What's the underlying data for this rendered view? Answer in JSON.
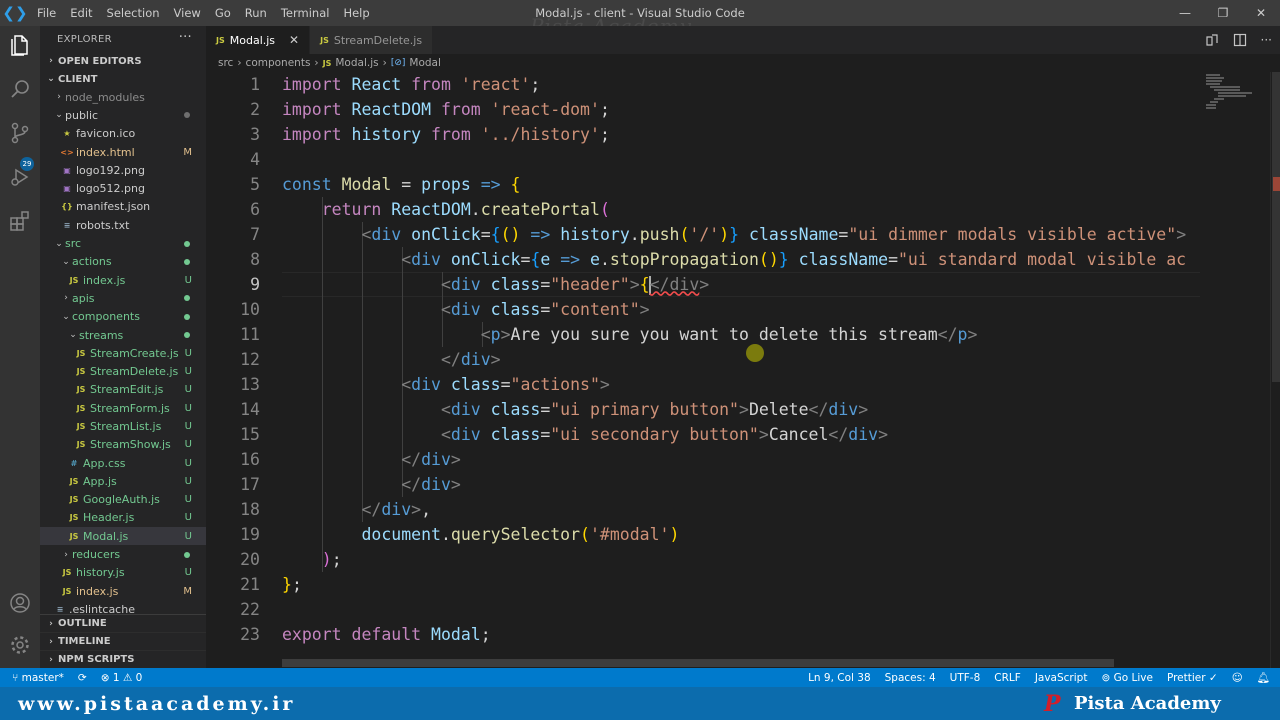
{
  "window": {
    "title": "Modal.js - client - Visual Studio Code",
    "watermark": "Pista Academy",
    "menu": [
      "File",
      "Edit",
      "Selection",
      "View",
      "Go",
      "Run",
      "Terminal",
      "Help"
    ]
  },
  "activity_bar": {
    "items": [
      "explorer-icon",
      "search-icon",
      "source-control-icon",
      "run-debug-icon",
      "extensions-icon"
    ],
    "source_control_badge": "29",
    "bottom": [
      "account-icon",
      "manage-gear-icon"
    ]
  },
  "sidebar": {
    "title": "EXPLORER",
    "more": "···",
    "open_editors": "OPEN EDITORS",
    "root": "CLIENT",
    "tree": [
      {
        "name": "node_modules",
        "type": "folder",
        "depth": 1,
        "open": false,
        "color": "gray"
      },
      {
        "name": "public",
        "type": "folder",
        "depth": 1,
        "open": true,
        "dot": "gray"
      },
      {
        "name": "favicon.ico",
        "type": "fav",
        "depth": 2
      },
      {
        "name": "index.html",
        "type": "html",
        "depth": 2,
        "status": "M"
      },
      {
        "name": "logo192.png",
        "type": "img",
        "depth": 2
      },
      {
        "name": "logo512.png",
        "type": "img",
        "depth": 2
      },
      {
        "name": "manifest.json",
        "type": "json",
        "depth": 2
      },
      {
        "name": "robots.txt",
        "type": "txt",
        "depth": 2
      },
      {
        "name": "src",
        "type": "folder",
        "depth": 1,
        "open": true,
        "dot": "green"
      },
      {
        "name": "actions",
        "type": "folder",
        "depth": 2,
        "open": true,
        "dot": "green"
      },
      {
        "name": "index.js",
        "type": "js",
        "depth": 3,
        "status": "U"
      },
      {
        "name": "apis",
        "type": "folder",
        "depth": 2,
        "open": false,
        "dot": "green"
      },
      {
        "name": "components",
        "type": "folder",
        "depth": 2,
        "open": true,
        "dot": "green"
      },
      {
        "name": "streams",
        "type": "folder",
        "depth": 3,
        "open": true,
        "dot": "green"
      },
      {
        "name": "StreamCreate.js",
        "type": "js",
        "depth": 4,
        "status": "U"
      },
      {
        "name": "StreamDelete.js",
        "type": "js",
        "depth": 4,
        "status": "U"
      },
      {
        "name": "StreamEdit.js",
        "type": "js",
        "depth": 4,
        "status": "U"
      },
      {
        "name": "StreamForm.js",
        "type": "js",
        "depth": 4,
        "status": "U"
      },
      {
        "name": "StreamList.js",
        "type": "js",
        "depth": 4,
        "status": "U"
      },
      {
        "name": "StreamShow.js",
        "type": "js",
        "depth": 4,
        "status": "U"
      },
      {
        "name": "App.css",
        "type": "css",
        "depth": 3,
        "status": "U"
      },
      {
        "name": "App.js",
        "type": "js",
        "depth": 3,
        "status": "U"
      },
      {
        "name": "GoogleAuth.js",
        "type": "js",
        "depth": 3,
        "status": "U"
      },
      {
        "name": "Header.js",
        "type": "js",
        "depth": 3,
        "status": "U"
      },
      {
        "name": "Modal.js",
        "type": "js",
        "depth": 3,
        "status": "U",
        "selected": true
      },
      {
        "name": "reducers",
        "type": "folder",
        "depth": 2,
        "open": false,
        "dot": "green"
      },
      {
        "name": "history.js",
        "type": "js",
        "depth": 2,
        "status": "U"
      },
      {
        "name": "index.js",
        "type": "js",
        "depth": 2,
        "status": "M"
      },
      {
        "name": ".eslintcache",
        "type": "txt",
        "depth": 1
      }
    ],
    "outline": "OUTLINE",
    "timeline": "TIMELINE",
    "npm_scripts": "NPM SCRIPTS"
  },
  "tabs": [
    {
      "label": "Modal.js",
      "active": true,
      "close": "✕"
    },
    {
      "label": "StreamDelete.js",
      "active": false
    }
  ],
  "breadcrumb": {
    "folders": [
      "src",
      "components"
    ],
    "file": "Modal.js",
    "symbol": "Modal"
  },
  "editor": {
    "current_line": 9,
    "line_numbers": [
      "1",
      "2",
      "3",
      "4",
      "5",
      "6",
      "7",
      "8",
      "9",
      "10",
      "11",
      "12",
      "13",
      "14",
      "15",
      "16",
      "17",
      "18",
      "19",
      "20",
      "21",
      "22",
      "23"
    ],
    "lines": [
      [
        [
          "kw",
          "import"
        ],
        [
          "txt",
          " "
        ],
        [
          "var",
          "React"
        ],
        [
          "txt",
          " "
        ],
        [
          "kw",
          "from"
        ],
        [
          "txt",
          " "
        ],
        [
          "str",
          "'react'"
        ],
        [
          "txt",
          ";"
        ]
      ],
      [
        [
          "kw",
          "import"
        ],
        [
          "txt",
          " "
        ],
        [
          "var",
          "ReactDOM"
        ],
        [
          "txt",
          " "
        ],
        [
          "kw",
          "from"
        ],
        [
          "txt",
          " "
        ],
        [
          "str",
          "'react-dom'"
        ],
        [
          "txt",
          ";"
        ]
      ],
      [
        [
          "kw",
          "import"
        ],
        [
          "txt",
          " "
        ],
        [
          "var",
          "history"
        ],
        [
          "txt",
          " "
        ],
        [
          "kw",
          "from"
        ],
        [
          "txt",
          " "
        ],
        [
          "str",
          "'../history'"
        ],
        [
          "txt",
          ";"
        ]
      ],
      [],
      [
        [
          "kw2",
          "const"
        ],
        [
          "txt",
          " "
        ],
        [
          "fn",
          "Modal"
        ],
        [
          "txt",
          " = "
        ],
        [
          "var",
          "props"
        ],
        [
          "txt",
          " "
        ],
        [
          "kw2",
          "=>"
        ],
        [
          "txt",
          " "
        ],
        [
          "yb",
          "{"
        ]
      ],
      [
        [
          "txt",
          "    "
        ],
        [
          "kw",
          "return"
        ],
        [
          "txt",
          " "
        ],
        [
          "var",
          "ReactDOM"
        ],
        [
          "txt",
          "."
        ],
        [
          "fn",
          "createPortal"
        ],
        [
          "pb",
          "("
        ]
      ],
      [
        [
          "txt",
          "        "
        ],
        [
          "br",
          "<"
        ],
        [
          "tag",
          "div"
        ],
        [
          "txt",
          " "
        ],
        [
          "attr",
          "onClick"
        ],
        [
          "txt",
          "="
        ],
        [
          "bb",
          "{"
        ],
        [
          "yb",
          "()"
        ],
        [
          "txt",
          " "
        ],
        [
          "kw2",
          "=>"
        ],
        [
          "txt",
          " "
        ],
        [
          "var",
          "history"
        ],
        [
          "txt",
          "."
        ],
        [
          "fn",
          "push"
        ],
        [
          "yb",
          "("
        ],
        [
          "str",
          "'/'"
        ],
        [
          "yb",
          ")"
        ],
        [
          "bb",
          "}"
        ],
        [
          "txt",
          " "
        ],
        [
          "attr",
          "className"
        ],
        [
          "txt",
          "="
        ],
        [
          "str",
          "\"ui dimmer modals visible active\""
        ],
        [
          "br",
          ">"
        ]
      ],
      [
        [
          "txt",
          "            "
        ],
        [
          "br",
          "<"
        ],
        [
          "tag",
          "div"
        ],
        [
          "txt",
          " "
        ],
        [
          "attr",
          "onClick"
        ],
        [
          "txt",
          "="
        ],
        [
          "bb",
          "{"
        ],
        [
          "var",
          "e"
        ],
        [
          "txt",
          " "
        ],
        [
          "kw2",
          "=>"
        ],
        [
          "txt",
          " "
        ],
        [
          "var",
          "e"
        ],
        [
          "txt",
          "."
        ],
        [
          "fn",
          "stopPropagation"
        ],
        [
          "yb",
          "()"
        ],
        [
          "bb",
          "}"
        ],
        [
          "txt",
          " "
        ],
        [
          "attr",
          "className"
        ],
        [
          "txt",
          "="
        ],
        [
          "str",
          "\"ui standard modal visible ac"
        ]
      ],
      [
        [
          "txt",
          "                "
        ],
        [
          "br",
          "<"
        ],
        [
          "tag",
          "div"
        ],
        [
          "txt",
          " "
        ],
        [
          "attr",
          "class"
        ],
        [
          "txt",
          "="
        ],
        [
          "str",
          "\"header\""
        ],
        [
          "br",
          ">"
        ],
        [
          "yb",
          "{"
        ],
        [
          "caret",
          ""
        ],
        [
          "squig",
          "</div"
        ],
        [
          "br",
          ">"
        ]
      ],
      [
        [
          "txt",
          "                "
        ],
        [
          "br",
          "<"
        ],
        [
          "tag",
          "div"
        ],
        [
          "txt",
          " "
        ],
        [
          "attr",
          "class"
        ],
        [
          "txt",
          "="
        ],
        [
          "str",
          "\"content\""
        ],
        [
          "br",
          ">"
        ]
      ],
      [
        [
          "txt",
          "                    "
        ],
        [
          "br",
          "<"
        ],
        [
          "tag",
          "p"
        ],
        [
          "br",
          ">"
        ],
        [
          "txt",
          "Are you sure you want to delete this stream"
        ],
        [
          "br",
          "</"
        ],
        [
          "tag",
          "p"
        ],
        [
          "br",
          ">"
        ]
      ],
      [
        [
          "txt",
          "                "
        ],
        [
          "br",
          "</"
        ],
        [
          "tag",
          "div"
        ],
        [
          "br",
          ">"
        ]
      ],
      [
        [
          "txt",
          "            "
        ],
        [
          "br",
          "<"
        ],
        [
          "tag",
          "div"
        ],
        [
          "txt",
          " "
        ],
        [
          "attr",
          "class"
        ],
        [
          "txt",
          "="
        ],
        [
          "str",
          "\"actions\""
        ],
        [
          "br",
          ">"
        ]
      ],
      [
        [
          "txt",
          "                "
        ],
        [
          "br",
          "<"
        ],
        [
          "tag",
          "div"
        ],
        [
          "txt",
          " "
        ],
        [
          "attr",
          "class"
        ],
        [
          "txt",
          "="
        ],
        [
          "str",
          "\"ui primary button\""
        ],
        [
          "br",
          ">"
        ],
        [
          "txt",
          "Delete"
        ],
        [
          "br",
          "</"
        ],
        [
          "tag",
          "div"
        ],
        [
          "br",
          ">"
        ]
      ],
      [
        [
          "txt",
          "                "
        ],
        [
          "br",
          "<"
        ],
        [
          "tag",
          "div"
        ],
        [
          "txt",
          " "
        ],
        [
          "attr",
          "class"
        ],
        [
          "txt",
          "="
        ],
        [
          "str",
          "\"ui secondary button\""
        ],
        [
          "br",
          ">"
        ],
        [
          "txt",
          "Cancel"
        ],
        [
          "br",
          "</"
        ],
        [
          "tag",
          "div"
        ],
        [
          "br",
          ">"
        ]
      ],
      [
        [
          "txt",
          "            "
        ],
        [
          "br",
          "</"
        ],
        [
          "tag",
          "div"
        ],
        [
          "br",
          ">"
        ]
      ],
      [
        [
          "txt",
          "            "
        ],
        [
          "br",
          "</"
        ],
        [
          "tag",
          "div"
        ],
        [
          "br",
          ">"
        ]
      ],
      [
        [
          "txt",
          "        "
        ],
        [
          "br",
          "</"
        ],
        [
          "tag",
          "div"
        ],
        [
          "br",
          ">"
        ],
        [
          "txt",
          ","
        ]
      ],
      [
        [
          "txt",
          "        "
        ],
        [
          "var",
          "document"
        ],
        [
          "txt",
          "."
        ],
        [
          "fn",
          "querySelector"
        ],
        [
          "yb",
          "("
        ],
        [
          "str",
          "'#modal'"
        ],
        [
          "yb",
          ")"
        ]
      ],
      [
        [
          "txt",
          "    "
        ],
        [
          "pb",
          ")"
        ],
        [
          "txt",
          ";"
        ]
      ],
      [
        [
          "yb",
          "}"
        ],
        [
          "txt",
          ";"
        ]
      ],
      [],
      [
        [
          "kw",
          "export"
        ],
        [
          "txt",
          " "
        ],
        [
          "kw",
          "default"
        ],
        [
          "txt",
          " "
        ],
        [
          "var",
          "Modal"
        ],
        [
          "txt",
          ";"
        ]
      ]
    ]
  },
  "statusbar": {
    "branch": "master*",
    "sync": "⟳",
    "problems": "⊗ 1 ⚠ 0",
    "position": "Ln 9, Col 38",
    "spaces": "Spaces: 4",
    "encoding": "UTF-8",
    "eol": "CRLF",
    "language": "JavaScript",
    "golive": "Go Live",
    "prettier": "Prettier"
  },
  "branding": {
    "url": "www.pistaacademy.ir",
    "logo": "P",
    "name": "Pista Academy"
  }
}
